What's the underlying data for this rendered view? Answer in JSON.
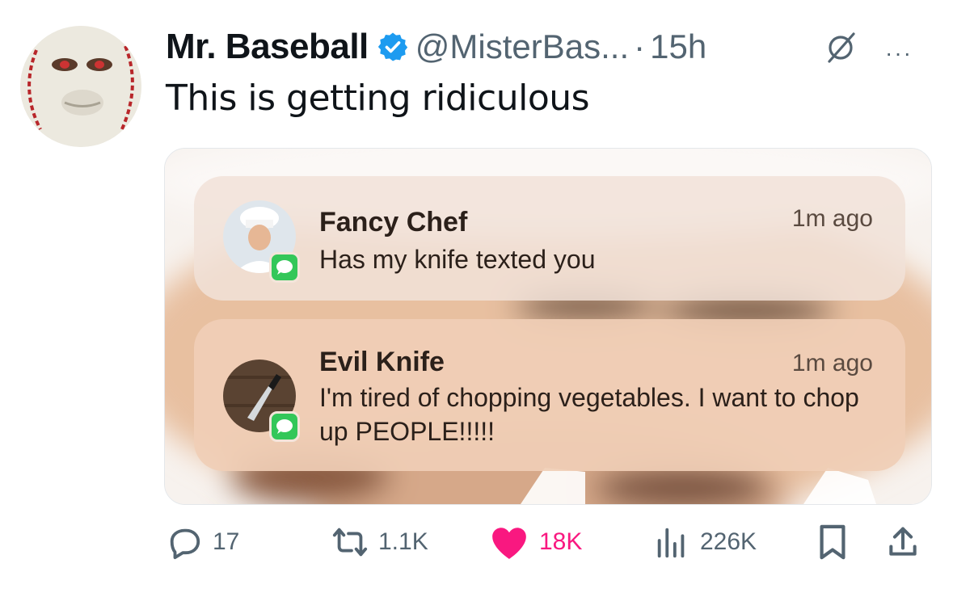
{
  "tweet": {
    "author_name": "Mr. Baseball",
    "handle": "@MisterBas...",
    "separator": "·",
    "time": "15h",
    "more": "···",
    "text": "This is getting ridiculous"
  },
  "notifications": [
    {
      "sender": "Fancy Chef",
      "message": "Has my knife texted you",
      "time": "1m ago"
    },
    {
      "sender": "Evil Knife",
      "message": "I'm tired of chopping vegetables. I want to chop up PEOPLE!!!!!",
      "time": "1m ago"
    }
  ],
  "actions": {
    "replies": "17",
    "reposts": "1.1K",
    "likes": "18K",
    "views": "226K"
  },
  "colors": {
    "verified": "#1d9bf0",
    "like": "#f91880",
    "muted": "#536471",
    "imessage": "#33c759"
  },
  "icons": [
    "verified-badge-icon",
    "grok-icon",
    "more-icon",
    "reply-icon",
    "repost-icon",
    "like-icon",
    "views-icon",
    "bookmark-icon",
    "share-icon",
    "messages-app-icon"
  ]
}
